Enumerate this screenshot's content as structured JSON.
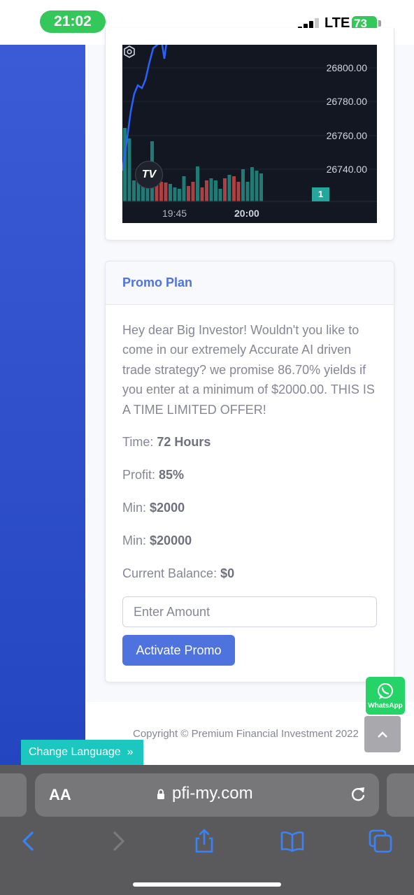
{
  "status_bar": {
    "time": "21:02",
    "network": "LTE",
    "battery": "73"
  },
  "chart_widget": {
    "price_labels": [
      "26800.00",
      "26780.00",
      "26760.00",
      "26740.00"
    ],
    "time_labels": [
      "19:45",
      "20:00"
    ],
    "logo_text": "TV",
    "badge": "1"
  },
  "promo": {
    "title": "Promo Plan",
    "description": "Hey dear Big Investor! Wouldn't you like to come in our extremely Accurate AI driven trade strategy? we promise 86.70% yields if you enter at a minimum of $2000.00. THIS IS A TIME LIMITED OFFER!",
    "time_label": "Time:",
    "time_value": "72 Hours",
    "profit_label": "Profit:",
    "profit_value": "85%",
    "min_label": "Min:",
    "min_value": "$2000",
    "max_label": "Min:",
    "max_value": "$20000",
    "balance_label": "Current Balance:",
    "balance_value": "$0",
    "amount_placeholder": "Enter Amount",
    "activate_label": "Activate Promo"
  },
  "footer": {
    "copyright": "Copyright © Premium Financial Investment 2022"
  },
  "floating": {
    "whatsapp_label": "WhatsApp",
    "scroll_top_icon": "chevron-up-icon",
    "change_language_label": "Change Language"
  },
  "browser": {
    "domain": "pfi-my.com",
    "text_size_label": "AA"
  },
  "colors": {
    "primary": "#4e73df",
    "chart_bg": "#131722",
    "up": "#26a69a",
    "down": "#ef5350",
    "whatsapp": "#25d366",
    "teal": "#1cc7c0"
  }
}
